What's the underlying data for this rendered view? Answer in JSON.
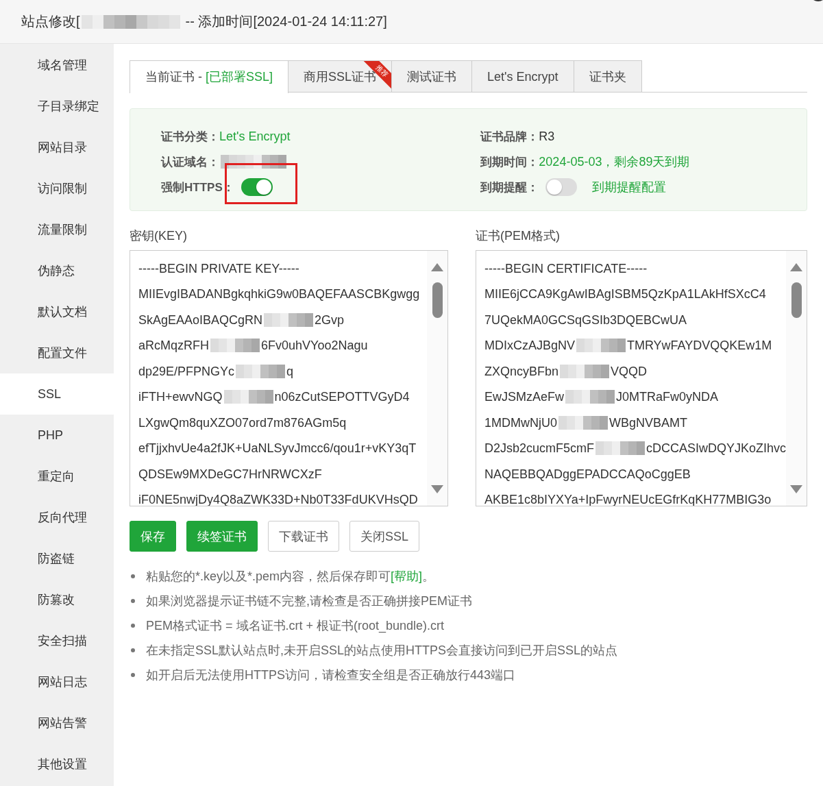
{
  "window": {
    "title": [
      "站点修改[",
      "-- 添加时间[2024-01-24 14:11:27]"
    ]
  },
  "sidebar": {
    "items": [
      {
        "label": "域名管理",
        "selected": false
      },
      {
        "label": "子目录绑定",
        "selected": false
      },
      {
        "label": "网站目录",
        "selected": false
      },
      {
        "label": "访问限制",
        "selected": false
      },
      {
        "label": "流量限制",
        "selected": false
      },
      {
        "label": "伪静态",
        "selected": false
      },
      {
        "label": "默认文档",
        "selected": false
      },
      {
        "label": "配置文件",
        "selected": false
      },
      {
        "label": "SSL",
        "selected": true
      },
      {
        "label": "PHP",
        "selected": false
      },
      {
        "label": "重定向",
        "selected": false
      },
      {
        "label": "反向代理",
        "selected": false
      },
      {
        "label": "防盗链",
        "selected": false
      },
      {
        "label": "防篡改",
        "selected": false
      },
      {
        "label": "安全扫描",
        "selected": false
      },
      {
        "label": "网站日志",
        "selected": false
      },
      {
        "label": "网站告警",
        "selected": false
      },
      {
        "label": "其他设置",
        "selected": false
      }
    ]
  },
  "tabs": [
    {
      "label": "当前证书 - ",
      "status": "[已部署SSL]",
      "selected": true
    },
    {
      "label": "商用SSL证书",
      "ribbon": "推荐",
      "selected": false
    },
    {
      "label": "测试证书",
      "selected": false
    },
    {
      "label": "Let's Encrypt",
      "selected": false
    },
    {
      "label": "证书夹",
      "selected": false
    }
  ],
  "cert_info": {
    "category_label": "证书分类：",
    "category": "Let's Encrypt",
    "brand_label": "证书品牌：",
    "brand": "R3",
    "domain_label": "认证域名：",
    "expiry_label": "到期时间：",
    "expiry": "2024-05-03，剩余89天到期",
    "force_https_label": "强制HTTPS：",
    "force_https": {
      "on": true,
      "highlighted": true
    },
    "reminder_label": "到期提醒：",
    "reminder": {
      "on": false
    },
    "reminder_link": "到期提醒配置"
  },
  "key": {
    "label": "密钥(KEY)",
    "lines": [
      [
        "-----BEGIN PRIVATE KEY-----"
      ],
      [
        "MIIEvgIBADANBgkqhkiG9w0BAQEFAASCBKgwgg"
      ],
      [
        "SkAgEAAoIBAQCgRN",
        "2Gvp"
      ],
      [
        "aRcMqzRFH",
        "6Fv0uhVYoo2Nagu"
      ],
      [
        "dp29E/PFPNGYc",
        "q"
      ],
      [
        "iFTH+ewvNGQ",
        "n06zCutSEPOTTVGyD4"
      ],
      [
        "LXgwQm8quXZO07ord7m876AGm5q"
      ],
      [
        "efTjjxhvUe4a2fJK+UaNLSyvJmcc6/qou1r+vKY3qT"
      ],
      [
        "QDSEw9MXDeGC7HrNRWCXzF"
      ],
      [
        "iF0NE5nwjDy4Q8aZWK33D+Nb0T33FdUKVHsQD"
      ]
    ]
  },
  "certificate": {
    "label": "证书(PEM格式)",
    "lines": [
      [
        "-----BEGIN CERTIFICATE-----"
      ],
      [
        "MIIE6jCCA9KgAwIBAgISBM5QzKpA1LAkHfSXcC4"
      ],
      [
        "7UQekMA0GCSqGSIb3DQEBCwUA"
      ],
      [
        "MDIxCzAJBgNV",
        "TMRYwFAYDVQQKEw1M"
      ],
      [
        "ZXQncyBFbn",
        "VQQD"
      ],
      [
        "EwJSMzAeFw",
        "J0MTRaFw0yNDA"
      ],
      [
        "1MDMwNjU0",
        "WBgNVBAMT"
      ],
      [
        "D2Jsb2cucmF5cmF",
        "cDCCASIwDQYJKoZIhvc"
      ],
      [
        "NAQEBBQADggEPADCCAQoCggEB"
      ],
      [
        "AKBE1c8bIYXYa+IpFwyrNEUcEGfrKqKH77MBIG3o"
      ]
    ]
  },
  "buttons": [
    {
      "label": "保存",
      "kind": "primary"
    },
    {
      "label": "续签证书",
      "kind": "primary"
    },
    {
      "label": "下载证书",
      "kind": "default"
    },
    {
      "label": "关闭SSL",
      "kind": "default"
    }
  ],
  "notes": [
    {
      "text": "粘贴您的*.key以及*.pem内容，然后保存即可",
      "link": "[帮助]",
      "after": "。"
    },
    {
      "text": "如果浏览器提示证书链不完整,请检查是否正确拼接PEM证书"
    },
    {
      "text": "PEM格式证书 = 域名证书.crt + 根证书(root_bundle).crt"
    },
    {
      "text": "在未指定SSL默认站点时,未开启SSL的站点使用HTTPS会直接访问到已开启SSL的站点"
    },
    {
      "text": "如开启后无法使用HTTPS访问，请检查安全组是否正确放行443端口"
    }
  ]
}
